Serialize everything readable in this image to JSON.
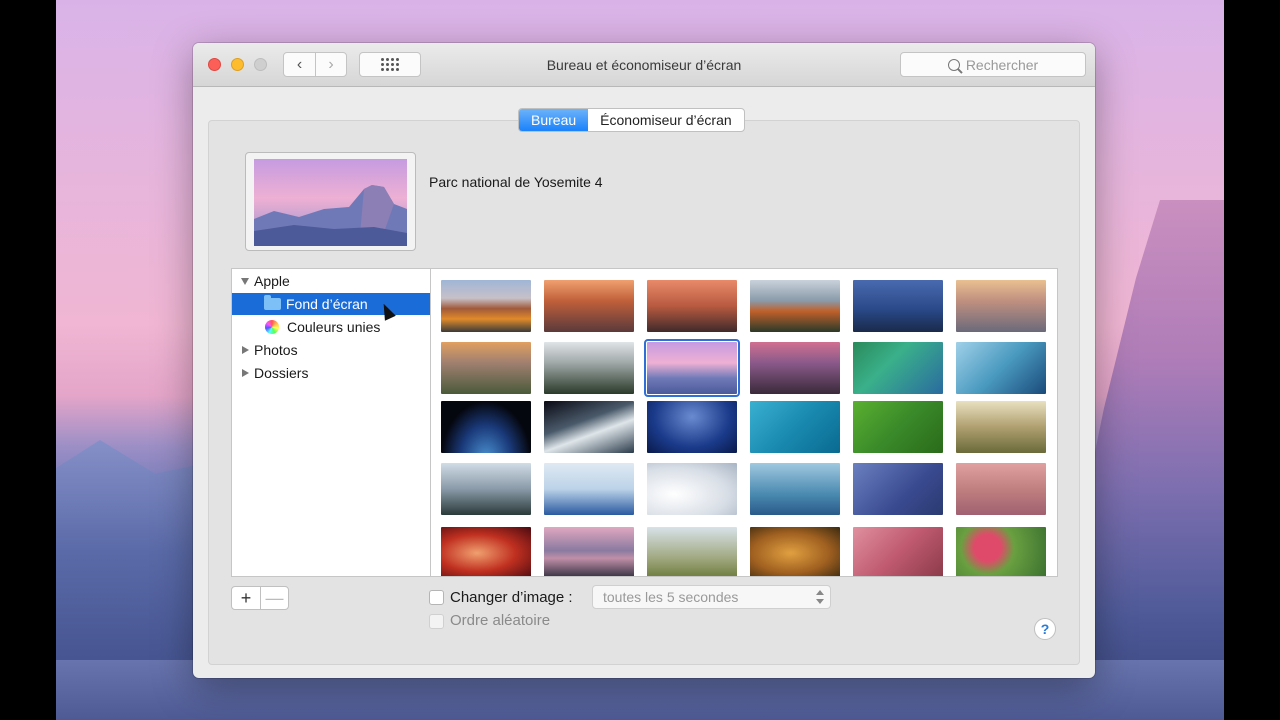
{
  "window": {
    "title": "Bureau et économiseur d’écran",
    "search_placeholder": "Rechercher"
  },
  "tabs": [
    {
      "label": "Bureau",
      "active": true
    },
    {
      "label": "Économiseur d’écran",
      "active": false
    }
  ],
  "current_wallpaper": {
    "name": "Parc national de Yosemite 4"
  },
  "sidebar": {
    "groups": [
      {
        "label": "Apple",
        "expanded": true
      },
      {
        "label": "Fond d’écran",
        "selected": true,
        "icon": "folder-icon"
      },
      {
        "label": "Couleurs unies",
        "selected": false,
        "icon": "color-wheel-icon"
      },
      {
        "label": "Photos",
        "expanded": false
      },
      {
        "label": "Dossiers",
        "expanded": false
      }
    ]
  },
  "gallery": {
    "selected_index": 8,
    "thumbnails": [
      "sierra-lake",
      "sierra-peaks",
      "el-capitan-sunset",
      "el-capitan-clouds",
      "yosemite-night",
      "half-dome-dusk",
      "yosemite-valley",
      "yosemite-fog",
      "half-dome-pink",
      "lake-sunset",
      "green-wave",
      "blue-wave",
      "earth-space",
      "earth-atmosphere",
      "milky-way",
      "blue-water",
      "green-fields",
      "foggy-field",
      "misty-mountains",
      "ice-cracks",
      "snow-dunes",
      "blue-trees",
      "blue-rocks",
      "pink-sand",
      "antelope-canyon",
      "lake-mountain",
      "elephant",
      "lion",
      "pink-grass",
      "poppies"
    ]
  },
  "controls": {
    "change_image_label": "Changer d’image :",
    "interval": "toutes les 5 secondes",
    "random_label": "Ordre aléatoire",
    "add_label": "+",
    "remove_label": "—",
    "help_label": "?"
  }
}
